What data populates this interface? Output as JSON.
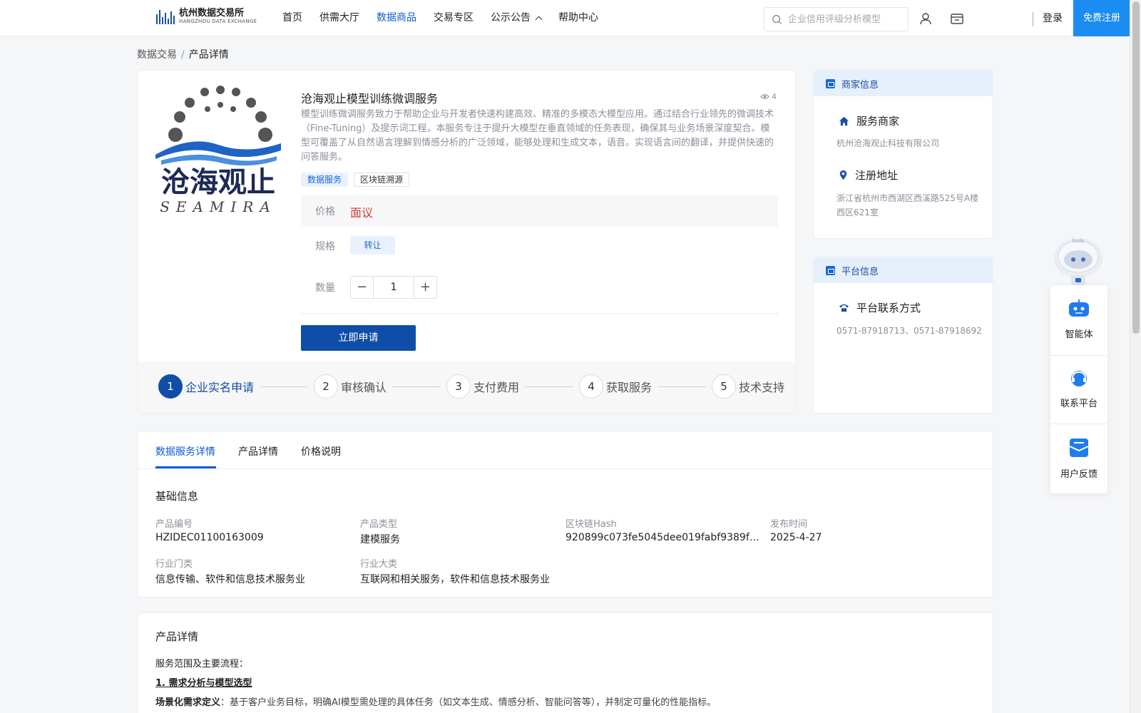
{
  "header": {
    "logo_cn": "杭州数据交易所",
    "logo_en": "HANGZHOU DATA EXCHANGE",
    "nav": [
      "首页",
      "供需大厅",
      "数据商品",
      "交易专区",
      "公示公告",
      "帮助中心"
    ],
    "nav_active_index": 2,
    "search_placeholder": "企业信用评级分析模型",
    "login": "登录",
    "register": "免费注册"
  },
  "breadcrumb": {
    "root": "数据交易",
    "separator": "/",
    "current": "产品详情"
  },
  "product": {
    "logo_text_cn": "沧海观止",
    "logo_text_en": "SEAMIRA",
    "title": "沧海观止模型训练微调服务",
    "views": "4",
    "description": "模型训练微调服务致力于帮助企业与开发者快速构建高效、精准的多模态大模型应用。通过结合行业领先的微调技术（Fine-Tuning）及提示词工程，本服务专注于提升大模型在垂直领域的任务表现，确保其与业务场景深度契合。模型可覆盖了从自然语言理解到情感分析的广泛领域，能够处理和生成文本，语音。实现语言间的翻译，并提供快速的问答服务。",
    "tags": [
      "数据服务",
      "区块链溯源"
    ],
    "price_label": "价格",
    "price_value": "面议",
    "spec_label": "规格",
    "spec_value": "转让",
    "qty_label": "数量",
    "qty_minus": "−",
    "qty_value": "1",
    "qty_plus": "+",
    "apply_button": "立即申请",
    "steps": [
      {
        "num": "1",
        "label": "企业实名申请"
      },
      {
        "num": "2",
        "label": "审核确认"
      },
      {
        "num": "3",
        "label": "支付费用"
      },
      {
        "num": "4",
        "label": "获取服务"
      },
      {
        "num": "5",
        "label": "技术支持"
      }
    ]
  },
  "merchant": {
    "header": "商家信息",
    "service_label": "服务商家",
    "service_value": "杭州沧海观止科技有限公司",
    "address_label": "注册地址",
    "address_value": "浙江省杭州市西湖区西溪路525号A楼西区621室"
  },
  "platform": {
    "header": "平台信息",
    "contact_label": "平台联系方式",
    "contact_value": "0571-87918713、0571-87918692"
  },
  "float_widget": {
    "robot_badge": "hzdx",
    "items": [
      "智能体",
      "联系平台",
      "用户反馈"
    ]
  },
  "details": {
    "tabs": [
      "数据服务详情",
      "产品详情",
      "价格说明"
    ],
    "active_tab": 0,
    "section_title": "基础信息",
    "fields": [
      {
        "label": "产品编号",
        "value": "HZIDEC01100163009"
      },
      {
        "label": "产品类型",
        "value": "建模服务"
      },
      {
        "label": "区块链Hash",
        "value": "920899c073fe5045dee019fabf9389faccbf…"
      },
      {
        "label": "发布时间",
        "value": "2025-4-27"
      },
      {
        "label": "行业门类",
        "value": "信息传输、软件和信息技术服务业"
      },
      {
        "label": "行业大类",
        "value": "互联网和相关服务，软件和信息技术服务业"
      }
    ]
  },
  "product_detail": {
    "title": "产品详情",
    "scope": "服务范围及主要流程：",
    "step1": "1. 需求分析与模型选型",
    "scene_label": "场景化需求定义",
    "scene_text": "：基于客户业务目标，明确AI模型需处理的具体任务（如文本生成、情感分析、智能问答等），并制定可量化的性能指标。"
  },
  "colors": {
    "primary": "#0f4ea8",
    "link": "#0d5bd7",
    "register_bg": "#1b8cf2",
    "price": "#d43c33"
  }
}
